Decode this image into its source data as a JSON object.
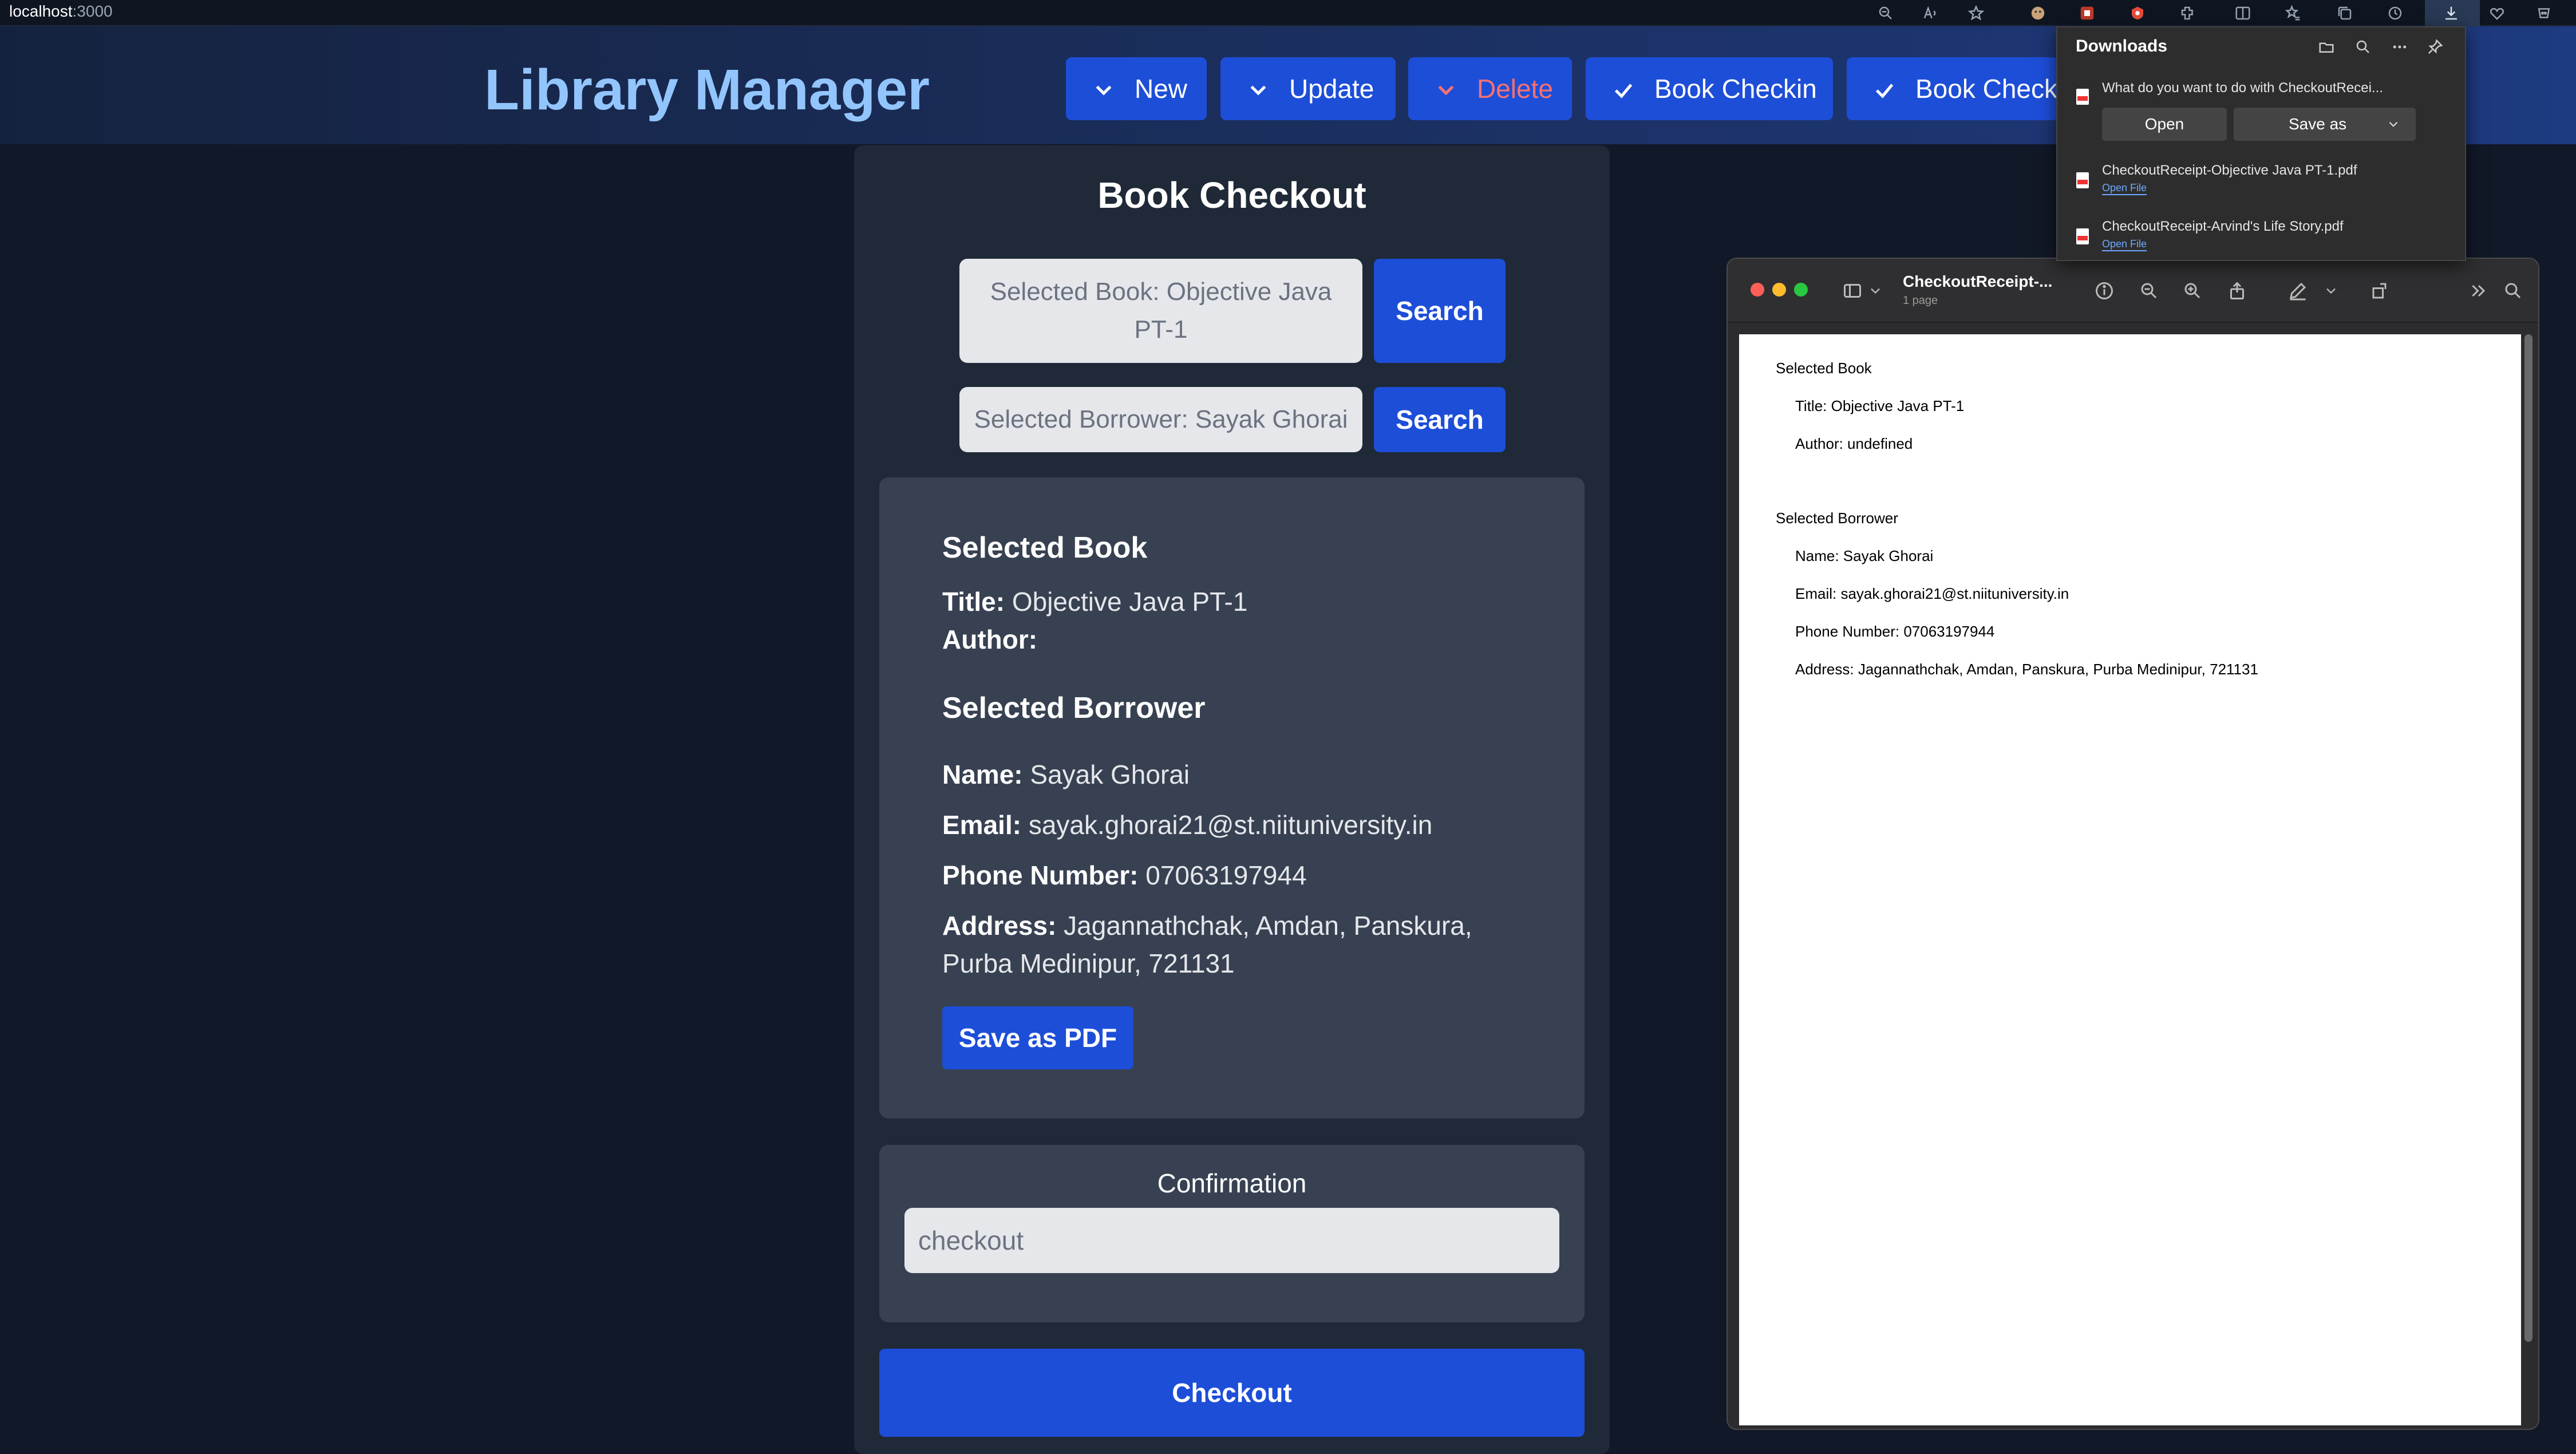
{
  "browser": {
    "url_host": "localhost",
    "url_port": ":3000",
    "icons": [
      "zoom-icon",
      "read-aloud-icon",
      "favorite-star-icon",
      "extension-icon",
      "extension-icon",
      "extension-icon",
      "extension-icon",
      "split-screen-icon",
      "favorites-icon",
      "collections-icon",
      "history-icon",
      "downloads-icon",
      "browser-essentials-icon",
      "copilot-icon"
    ]
  },
  "app": {
    "title": "Library Manager",
    "nav": {
      "new": "New",
      "update": "Update",
      "delete": "Delete",
      "book_checkin": "Book Checkin",
      "book_checkout": "Book Checkout"
    }
  },
  "checkout": {
    "title": "Book Checkout",
    "book_search_value": "Selected Book: Objective Java PT-1",
    "borrower_search_value": "Selected Borrower: Sayak Ghorai",
    "search_label": "Search",
    "selected_book_heading": "Selected Book",
    "title_label": "Title:",
    "book_title": "Objective Java PT-1",
    "author_label": "Author:",
    "author": "",
    "selected_borrower_heading": "Selected Borrower",
    "name_label": "Name:",
    "name": "Sayak Ghorai",
    "email_label": "Email:",
    "email": "sayak.ghorai21@st.niituniversity.in",
    "phone_label": "Phone Number:",
    "phone": "07063197944",
    "address_label": "Address:",
    "address": "Jagannathchak, Amdan, Panskura, Purba Medinipur, 721131",
    "save_pdf_label": "Save as PDF",
    "confirmation_label": "Confirmation",
    "confirmation_value": "checkout",
    "checkout_label": "Checkout"
  },
  "downloads": {
    "title": "Downloads",
    "question": "What do you want to do with CheckoutRecei...",
    "open_label": "Open",
    "save_as_label": "Save as",
    "files": [
      {
        "name": "CheckoutReceipt-Objective Java PT-1.pdf",
        "link": "Open File"
      },
      {
        "name": "CheckoutReceipt-Arvind's Life Story.pdf",
        "link": "Open File"
      }
    ]
  },
  "preview": {
    "title": "CheckoutReceipt-...",
    "pages": "1 page",
    "lines": {
      "book_heading": "Selected Book",
      "book_title": "Title: Objective Java PT-1",
      "book_author": "Author: undefined",
      "borrower_heading": "Selected Borrower",
      "borrower_name": "Name: Sayak Ghorai",
      "borrower_email": "Email: sayak.ghorai21@st.niituniversity.in",
      "borrower_phone": "Phone Number: 07063197944",
      "borrower_address": "Address: Jagannathchak, Amdan, Panskura, Purba Medinipur, 721131"
    }
  },
  "colors": {
    "accent": "#1d4ed8",
    "title_blue": "#93c5fd",
    "delete_red": "#f87171",
    "page_bg": "#111827",
    "card_bg": "#374151"
  }
}
